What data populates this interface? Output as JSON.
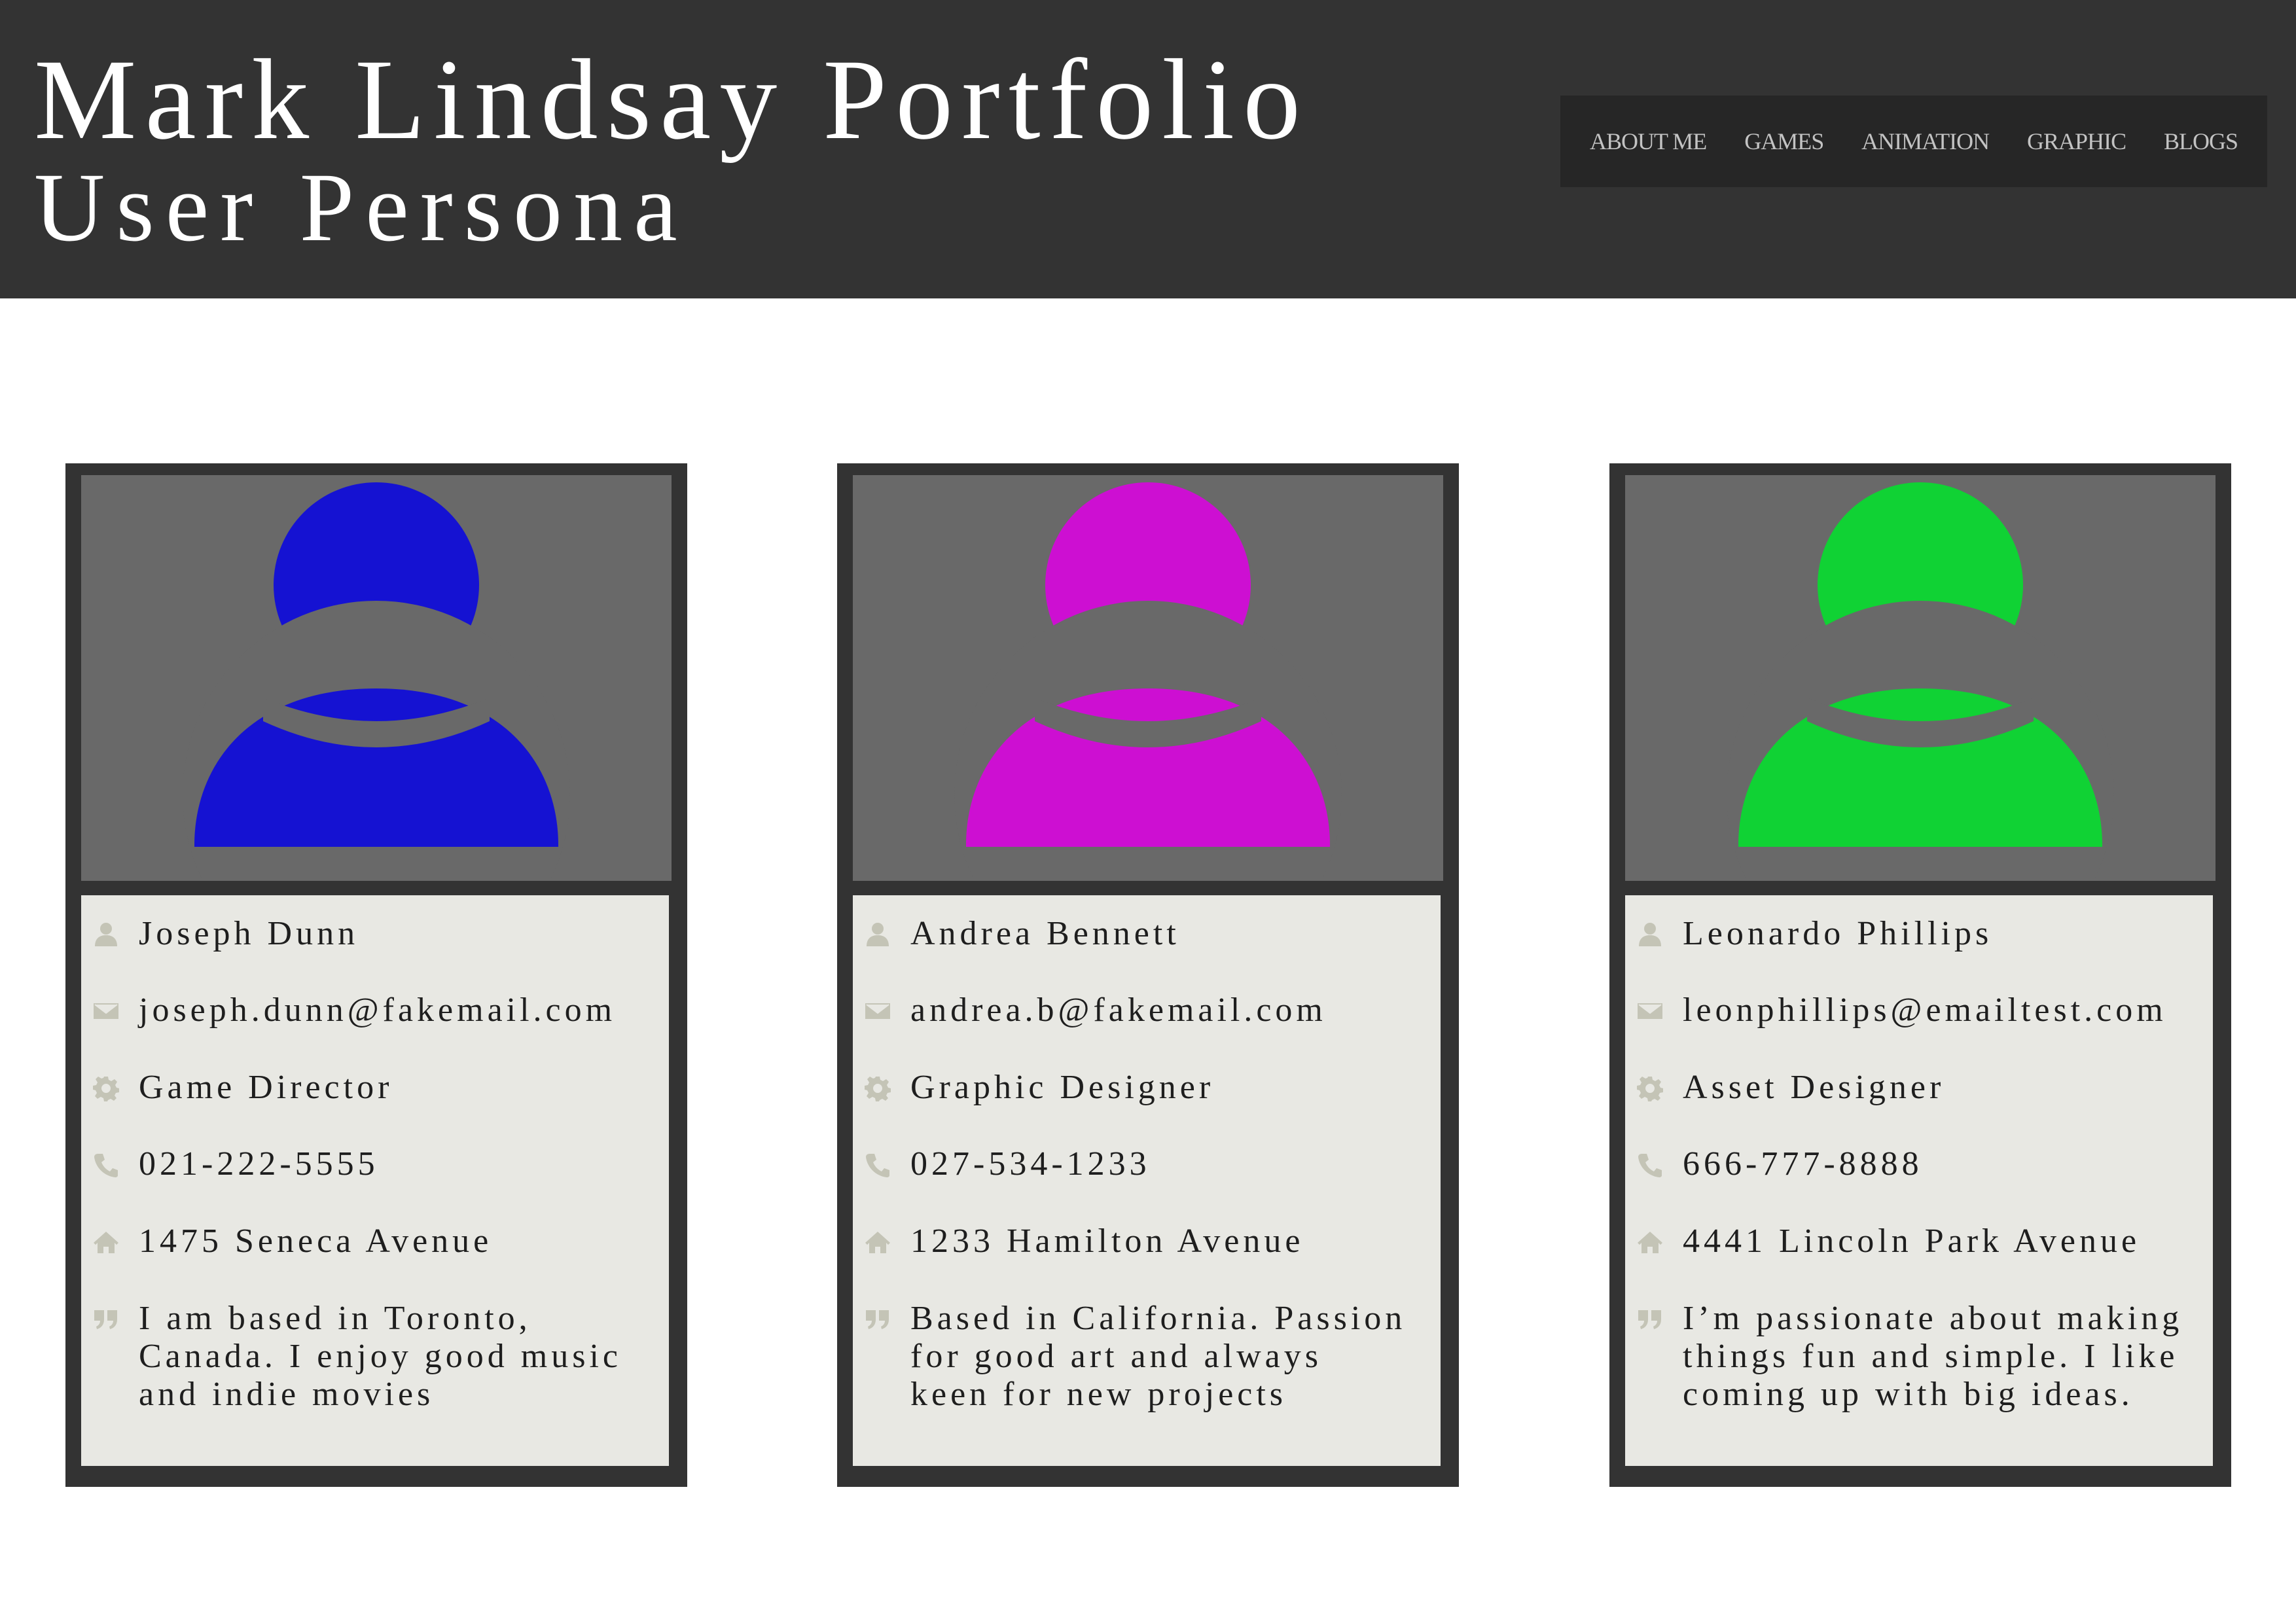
{
  "header": {
    "title": "Mark Lindsay Portfolio",
    "subtitle": "User Persona"
  },
  "nav": {
    "items": [
      {
        "label": "ABOUT ME"
      },
      {
        "label": "GAMES"
      },
      {
        "label": "ANIMATION"
      },
      {
        "label": "GRAPHIC"
      },
      {
        "label": "BLOGS"
      }
    ]
  },
  "icons": {
    "name": "user-icon",
    "email": "envelope-icon",
    "role": "gear-icon",
    "phone": "phone-icon",
    "address": "home-icon",
    "bio": "quote-icon"
  },
  "personas": [
    {
      "avatar_color": "#1512d2",
      "name": "Joseph Dunn",
      "email": "joseph.dunn@fakemail.com",
      "role": "Game Director",
      "phone": "021-222-5555",
      "address": "1475 Seneca Avenue",
      "bio": "I am based in Toronto,\nCanada. I enjoy good music\nand indie movies"
    },
    {
      "avatar_color": "#cd0fd2",
      "name": "Andrea Bennett",
      "email": "andrea.b@fakemail.com",
      "role": "Graphic Designer",
      "phone": "027-534-1233",
      "address": "1233 Hamilton Avenue",
      "bio": "Based in California. Passion\nfor good art and always\nkeen for new projects"
    },
    {
      "avatar_color": "#10d234",
      "name": "Leonardo Phillips",
      "email": "leonphillips@emailtest.com",
      "role": "Asset Designer",
      "phone": "666-777-8888",
      "address": "4441 Lincoln Park Avenue",
      "bio": "I’m passionate about making\nthings fun and simple. I like\ncoming up with big ideas."
    }
  ]
}
